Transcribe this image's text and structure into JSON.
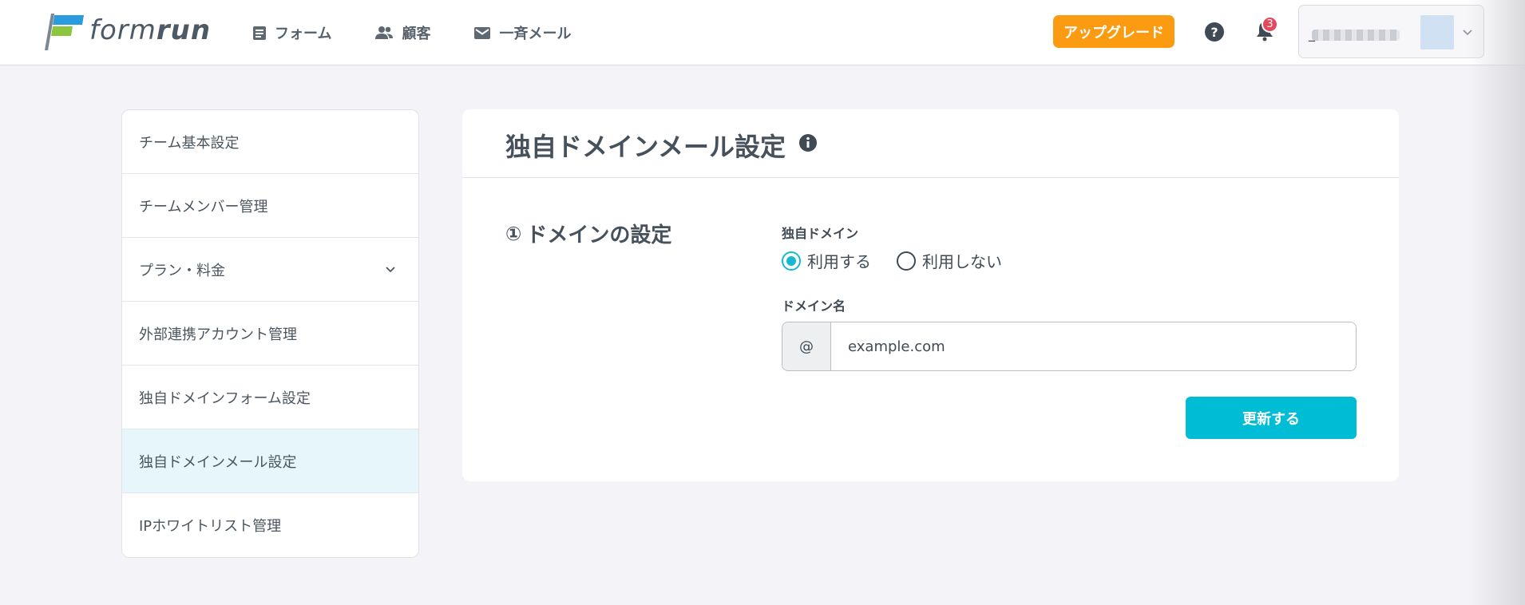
{
  "brand": {
    "logo_text_light": "form",
    "logo_text_bold": "run"
  },
  "nav": {
    "items": [
      {
        "label": "フォーム",
        "icon": "form-icon"
      },
      {
        "label": "顧客",
        "icon": "customers-icon"
      },
      {
        "label": "一斉メール",
        "icon": "mail-icon"
      }
    ]
  },
  "header": {
    "upgrade_label": "アップグレード",
    "notification_count": "3",
    "account_label": "_"
  },
  "sidebar": {
    "items": [
      {
        "label": "チーム基本設定"
      },
      {
        "label": "チームメンバー管理"
      },
      {
        "label": "プラン・料金"
      },
      {
        "label": "外部連携アカウント管理"
      },
      {
        "label": "独自ドメインフォーム設定"
      },
      {
        "label": "独自ドメインメール設定"
      },
      {
        "label": "IPホワイトリスト管理"
      }
    ],
    "active_index": 5
  },
  "main": {
    "title": "独自ドメインメール設定",
    "section_number": "①",
    "section_title": "ドメインの設定",
    "custom_domain_label": "独自ドメイン",
    "radio_use": "利用する",
    "radio_not_use": "利用しない",
    "radio_selected": "use",
    "domain_name_label": "ドメイン名",
    "at_prefix": "@",
    "domain_placeholder": "example.com",
    "submit_label": "更新する"
  },
  "colors": {
    "accent": "#00bcd4",
    "upgrade": "#fa9b12",
    "badge": "#e4485a",
    "active_sidebar": "#e6f6fa"
  }
}
